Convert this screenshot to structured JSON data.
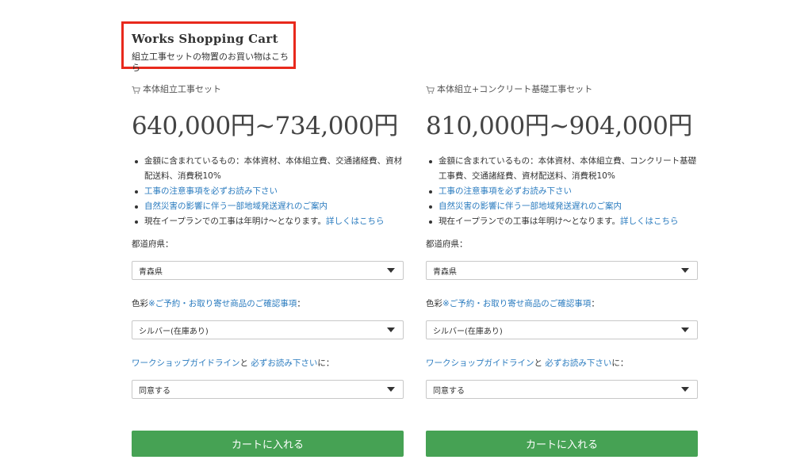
{
  "header": {
    "title": "Works Shopping Cart",
    "subtitle": "組立工事セットの物置のお買い物はこちら"
  },
  "products": [
    {
      "title": "本体組立工事セット",
      "price": "640,000円~734,000円",
      "bullets": {
        "included": "金額に含まれているもの：本体資材、本体組立費、交通諸経費、資材配送料、消費税10%",
        "notes_link": "工事の注意事項を必ずお読み下さい",
        "disaster_link": "自然災害の影響に伴う一部地域発送遅れのご案内",
        "schedule_text": "現在イープランでの工事は年明け〜となります。",
        "schedule_link": "詳しくはこちら"
      },
      "prefecture_label": "都道府県：",
      "prefecture_value": "青森県",
      "color_label": "色彩",
      "color_link": "※ご予約・お取り寄せ商品のご確認事項",
      "color_suffix": "：",
      "color_value": "シルバー(在庫あり)",
      "guideline_link": "ワークショップガイドライン",
      "guideline_and": "と",
      "guideline_link2": "必ずお読み下さい",
      "guideline_suffix": "に：",
      "agree_value": "同意する",
      "cart_button": "カートに入れる"
    },
    {
      "title": "本体組立+コンクリート基礎工事セット",
      "price": "810,000円~904,000円",
      "bullets": {
        "included": "金額に含まれているもの：本体資材、本体組立費、コンクリート基礎工事費、交通諸経費、資材配送料、消費税10%",
        "notes_link": "工事の注意事項を必ずお読み下さい",
        "disaster_link": "自然災害の影響に伴う一部地域発送遅れのご案内",
        "schedule_text": "現在イープランでの工事は年明け〜となります。",
        "schedule_link": "詳しくはこちら"
      },
      "prefecture_label": "都道府県：",
      "prefecture_value": "青森県",
      "color_label": "色彩",
      "color_link": "※ご予約・お取り寄せ商品のご確認事項",
      "color_suffix": "：",
      "color_value": "シルバー(在庫あり)",
      "guideline_link": "ワークショップガイドライン",
      "guideline_and": "と",
      "guideline_link2": "必ずお読み下さい",
      "guideline_suffix": "に：",
      "agree_value": "同意する",
      "cart_button": "カートに入れる"
    }
  ],
  "colors": {
    "highlight_border": "#e8291c",
    "link": "#2a7bbf",
    "button": "#46a254"
  },
  "icons": [
    "cart-icon",
    "chevron-down-icon"
  ]
}
